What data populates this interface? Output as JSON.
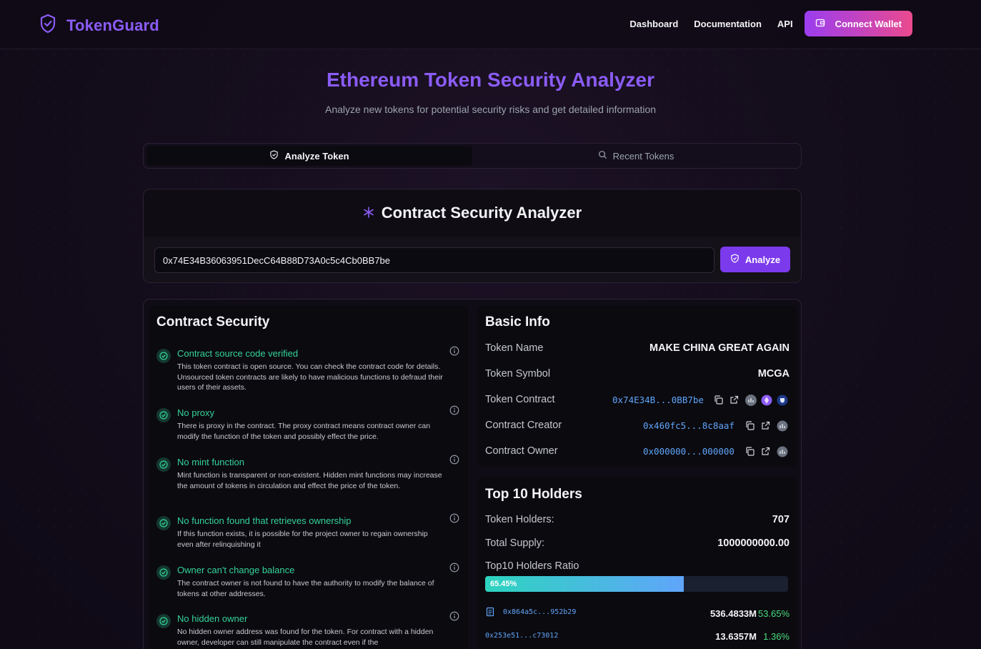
{
  "brand": {
    "name": "TokenGuard"
  },
  "nav": {
    "items": [
      "Dashboard",
      "Documentation",
      "API"
    ],
    "connect_wallet": "Connect Wallet"
  },
  "hero": {
    "title": "Ethereum Token Security Analyzer",
    "subtitle": "Analyze new tokens for potential security risks and get detailed information"
  },
  "tabs": {
    "analyze": "Analyze Token",
    "recent": "Recent Tokens"
  },
  "analyzer": {
    "title": "Contract Security Analyzer",
    "address_value": "0x74E34B36063951DecC64B88D73A0c5c4Cb0BB7be",
    "button": "Analyze"
  },
  "security": {
    "title": "Contract Security",
    "items": [
      {
        "title": "Contract source code verified",
        "desc": "This token contract is open source. You can check the contract code for details. Unsourced token contracts are likely to have malicious functions to defraud their users of their assets."
      },
      {
        "title": "No proxy",
        "desc": "There is proxy in the contract. The proxy contract means contract owner can modify the function of the token and possibly effect the price."
      },
      {
        "title": "No mint function",
        "desc": "Mint function is transparent or non-existent. Hidden mint functions may increase the amount of tokens in circulation and effect the price of the token."
      },
      {
        "title": "No function found that retrieves ownership",
        "desc": "If this function exists, it is possible for the project owner to regain ownership even after relinquishing it"
      },
      {
        "title": "Owner can't change balance",
        "desc": "The contract owner is not found to have the authority to modify the balance of tokens at other addresses."
      },
      {
        "title": "No hidden owner",
        "desc": "No hidden owner address was found for the token. For contract with a hidden owner, developer can still manipulate the contract even if the"
      }
    ]
  },
  "basic_info": {
    "title": "Basic Info",
    "token_name_label": "Token Name",
    "token_name": "MAKE CHINA GREAT AGAIN",
    "token_symbol_label": "Token Symbol",
    "token_symbol": "MCGA",
    "token_contract_label": "Token Contract",
    "token_contract": "0x74E34B...0BB7be",
    "creator_label": "Contract Creator",
    "creator": "0x460fc5...8c8aaf",
    "owner_label": "Contract Owner",
    "owner": "0x000000...000000"
  },
  "holders": {
    "title": "Top 10 Holders",
    "holders_label": "Token Holders:",
    "holders_count": "707",
    "supply_label": "Total Supply:",
    "supply": "1000000000.00",
    "ratio_label": "Top10 Holders Ratio",
    "ratio_text": "65.45%",
    "ratio": 0.6545,
    "rows": [
      {
        "addr": "0x864a5c...952b29",
        "amount": "536.4833M",
        "pct": "53.65%"
      },
      {
        "addr": "0x253e51...c73012",
        "amount": "13.6357M",
        "pct": "1.36%"
      }
    ]
  },
  "colors": {
    "accent": "#8b5cf6",
    "success": "#34d399",
    "link": "#60a5fa"
  }
}
